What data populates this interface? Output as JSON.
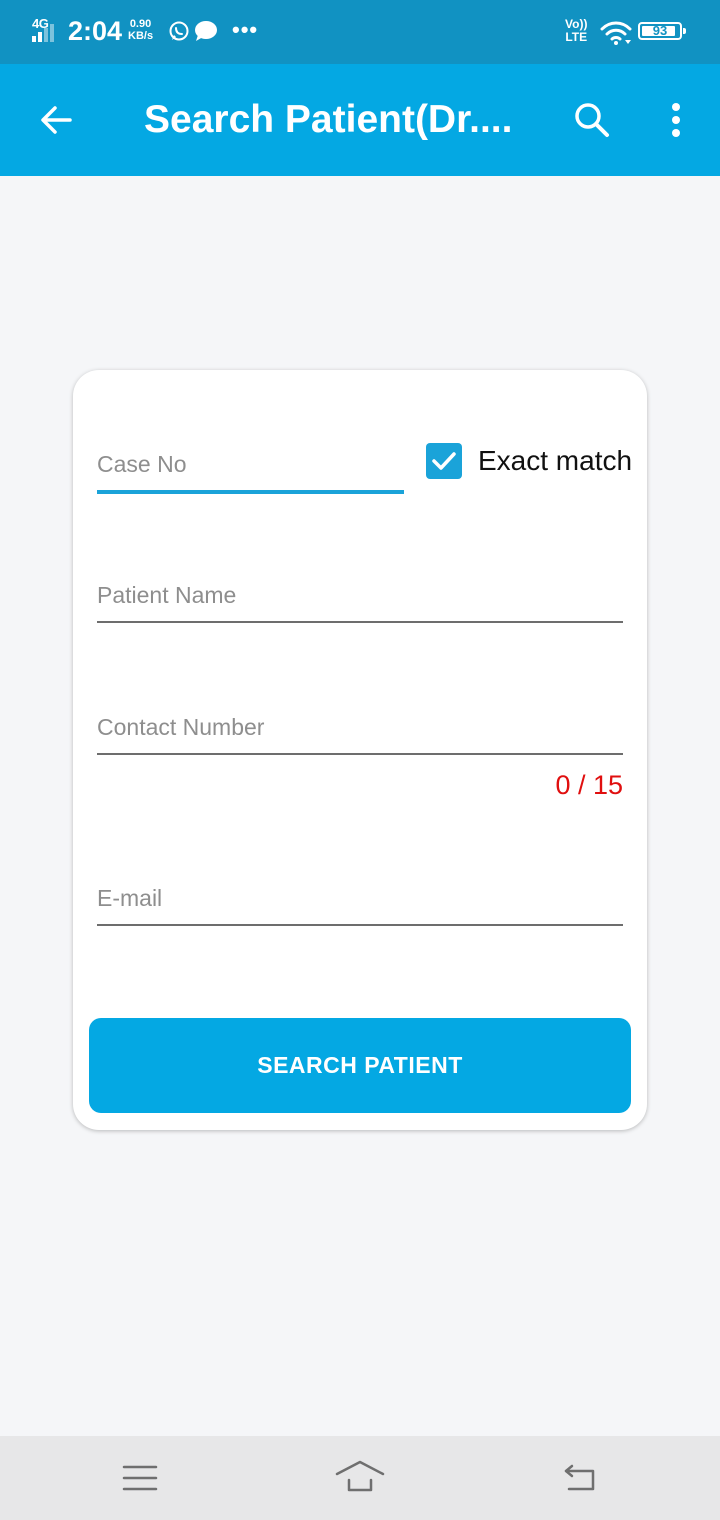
{
  "status_bar": {
    "network": "4G",
    "time": "2:04",
    "speed_value": "0.90",
    "speed_unit": "KB/s",
    "overflow": "•••",
    "volte_top": "Vo))",
    "volte_bottom": "LTE",
    "battery": "93",
    "battery_level": 0.93,
    "icons": [
      "signal-icon",
      "whatsapp-icon",
      "message-icon",
      "wifi-icon",
      "battery-icon"
    ]
  },
  "app_bar": {
    "title": "Search Patient(Dr....",
    "icons": [
      "back-arrow-icon",
      "search-icon",
      "more-vert-icon"
    ]
  },
  "form": {
    "case_no": {
      "placeholder": "Case No",
      "value": ""
    },
    "exact_match": {
      "label": "Exact match",
      "checked": true
    },
    "patient_name": {
      "placeholder": "Patient Name",
      "value": ""
    },
    "contact_number": {
      "placeholder": "Contact Number",
      "value": "",
      "counter": "0 / 15"
    },
    "email": {
      "placeholder": "E-mail",
      "value": ""
    },
    "submit_label": "SEARCH PATIENT"
  },
  "nav_bar": {
    "icons": [
      "menu-icon",
      "home-icon",
      "back-icon"
    ]
  },
  "colors": {
    "status_bar": "#1192c2",
    "primary": "#04a8e3",
    "accent": "#1aa3d9",
    "error": "#e00f0f",
    "background": "#f5f6f8"
  }
}
